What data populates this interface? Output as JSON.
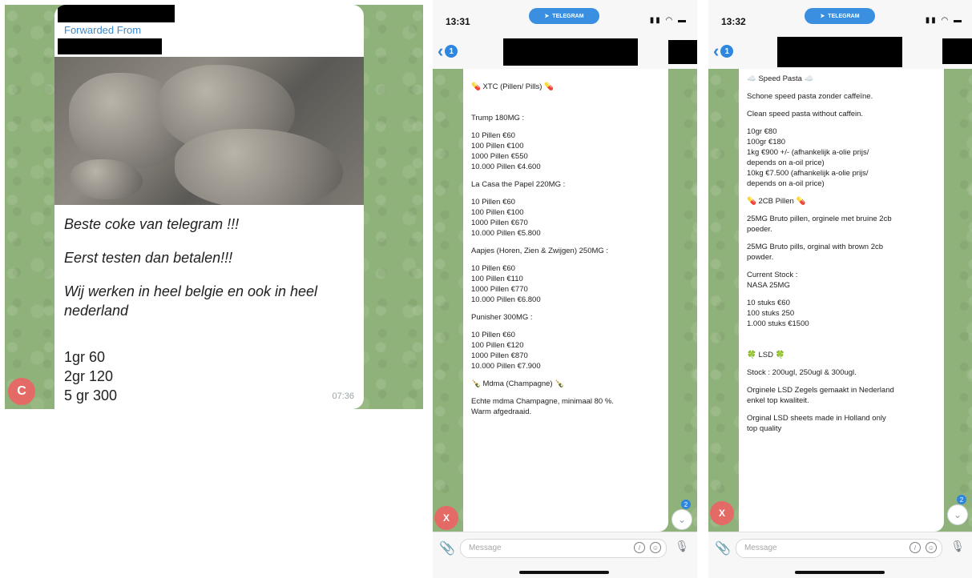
{
  "panel1": {
    "forwarded_label": "Forwarded From",
    "message_lines": [
      "Beste coke van telegram !!!",
      "Eerst testen dan betalen!!!",
      "Wij werken in heel belgie en ook in heel nederland"
    ],
    "prices": [
      "1gr 60",
      "2gr 120",
      "5 gr 300"
    ],
    "time": "07:36",
    "avatar_letter": "C",
    "colors": {
      "link": "#3d88c9",
      "avatar": "#e46b65"
    }
  },
  "phone2": {
    "time": "13:31",
    "app_pill": "TELEGRAM",
    "back_badge": "1",
    "lines": [
      "💊 XTC (Pillen/ Pills) 💊",
      "",
      "",
      "Trump 180MG :",
      "",
      "10 Pillen €60",
      "100 Pillen €100",
      "1000 Pillen €550",
      "10.000 Pillen €4.600",
      "",
      "La Casa the Papel 220MG :",
      "",
      "10 Pillen €60",
      "100 Pillen €100",
      "1000 Pillen €670",
      "10.000 Pillen €5.800",
      "",
      "Aapjes (Horen, Zien & Zwijgen) 250MG :",
      "",
      "10 Pillen €60",
      "100 Pillen €110",
      "1000 Pillen €770",
      "10.000 Pillen €6.800",
      "",
      "Punisher 300MG :",
      "",
      "10 Pillen €60",
      "100 Pillen €120",
      "1000 Pillen €870",
      "10.000 Pillen €7.900",
      "",
      "🍾 Mdma (Champagne) 🍾",
      "",
      "Echte mdma Champagne, minimaal 80 %.",
      "Warm afgedraaid."
    ],
    "avatar_letter": "X",
    "scroll_badge": "2",
    "message_placeholder": "Message"
  },
  "phone3": {
    "time": "13:32",
    "app_pill": "TELEGRAM",
    "back_badge": "1",
    "lines": [
      "☁️ Speed Pasta ☁️",
      "",
      "Schone speed pasta zonder caffeïne.",
      "",
      "Clean speed pasta without caffein.",
      "",
      "10gr €80",
      "100gr €180",
      "1kg €900 +/- (afhankelijk a-olie prijs/",
      "depends on a-oil price)",
      "10kg €7.500 (afhankelijk a-olie prijs/",
      "depends on a-oil price)",
      "",
      "💊 2CB Pillen 💊",
      "",
      "25MG Bruto pillen, orginele met bruine 2cb",
      "poeder.",
      "",
      "25MG Bruto pills, orginal with brown 2cb",
      "powder.",
      "",
      "Current Stock :",
      "NASA 25MG",
      "",
      "10 stuks €60",
      "100 stuks 250",
      "1.000 stuks €1500",
      "",
      "",
      "🍀 LSD 🍀",
      "",
      "Stock : 200ugl, 250ugl & 300ugl.",
      "",
      "Orginele LSD Zegels gemaakt in Nederland",
      "enkel top kwaliteit.",
      "",
      "Orginal LSD sheets made in Holland only",
      "top quality"
    ],
    "avatar_letter": "X",
    "scroll_badge": "2",
    "message_placeholder": "Message"
  }
}
